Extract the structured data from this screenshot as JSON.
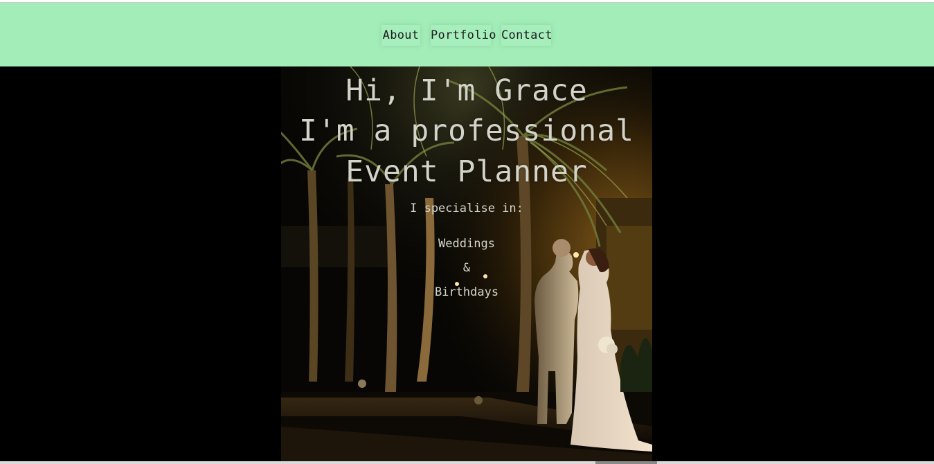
{
  "nav": {
    "items": [
      {
        "label": "About"
      },
      {
        "label": "Portfolio"
      },
      {
        "label": "Contact"
      }
    ]
  },
  "hero": {
    "heading_line1": "Hi, I'm Grace",
    "heading_line2": "I'm a professional",
    "heading_line3": "Event Planner",
    "specialise_label": "I specialise in:",
    "specialties": [
      "Weddings",
      "&",
      "Birthdays"
    ]
  },
  "colors": {
    "nav_background": "#a2edb8",
    "page_background": "#000000",
    "hero_text": "#d3d3c9"
  }
}
